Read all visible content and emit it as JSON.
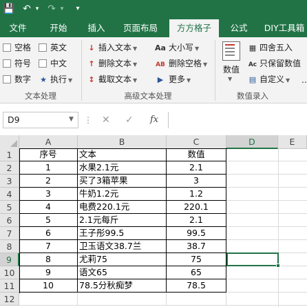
{
  "titlebar": {
    "save_icon": "save-icon",
    "undo_icon": "undo-icon",
    "redo_icon": "redo-icon",
    "customize_icon": "customize-icon"
  },
  "tabs": [
    "文件",
    "开始",
    "插入",
    "页面布局",
    "方方格子",
    "公式",
    "DIY工具箱"
  ],
  "active_tab": "方方格子",
  "ribbon": {
    "text_group": {
      "label": "文本处理",
      "checkboxes": [
        "空格",
        "英文",
        "符号",
        "中文",
        "数字"
      ],
      "execute": "执行"
    },
    "advanced_group": {
      "label": "高级文本处理",
      "insert_text": "插入文本",
      "delete_text": "删除文本",
      "extract_text": "截取文本",
      "case": "大小写",
      "delete_spaces": "删除空格",
      "more": "更多"
    },
    "number_group": {
      "label": "数值录入",
      "numeric": "数值",
      "round": "四舍五入",
      "keep_numeric": "只保留数值",
      "custom": "自定义"
    }
  },
  "formula_bar": {
    "name_box": "D9",
    "fx": "fx",
    "formula": ""
  },
  "grid": {
    "columns": [
      "A",
      "B",
      "C",
      "D",
      "E"
    ],
    "selected_column": "D",
    "rows": [
      "1",
      "2",
      "3",
      "4",
      "5",
      "6",
      "7",
      "8",
      "9",
      "10",
      "11",
      "12"
    ],
    "selected_row": "9",
    "table": [
      [
        "序号",
        "文本",
        "数值"
      ],
      [
        "1",
        "水果2.1元",
        "2.1"
      ],
      [
        "2",
        "买了3箱苹果",
        "3"
      ],
      [
        "3",
        "牛奶1.2元",
        "1.2"
      ],
      [
        "4",
        "电费220.1元",
        "220.1"
      ],
      [
        "5",
        "2.1元每斤",
        "2.1"
      ],
      [
        "6",
        "王子彤99.5",
        "99.5"
      ],
      [
        "7",
        "卫玉语文38.7兰",
        "38.7"
      ],
      [
        "8",
        "尤莉75",
        "75"
      ],
      [
        "9",
        "语文65",
        "65"
      ],
      [
        "10",
        "78.5分秋痴梦",
        "78.5"
      ]
    ]
  },
  "colors": {
    "accent": "#217346",
    "tab_text": "#ffffff",
    "ribbon_bg": "#f3f3f3",
    "header_bg": "#e6e6e6"
  }
}
